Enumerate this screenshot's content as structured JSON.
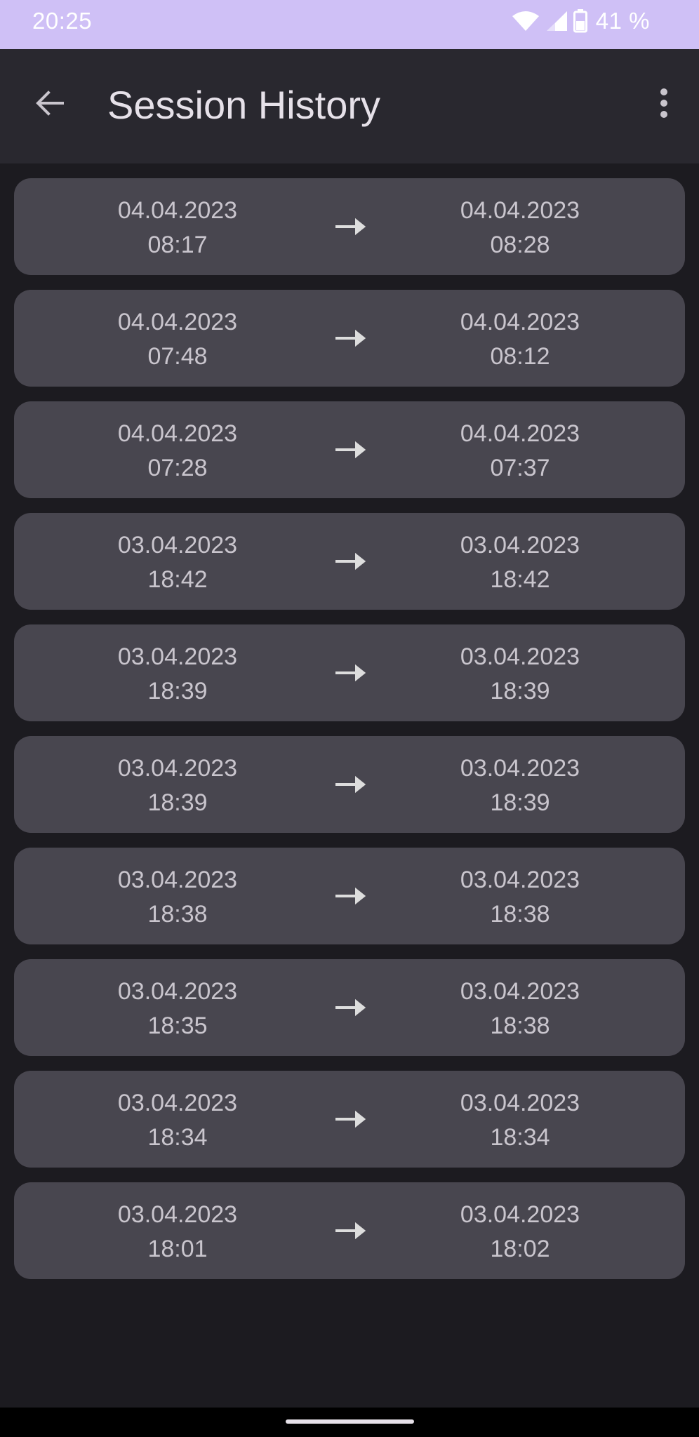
{
  "status_bar": {
    "time": "20:25",
    "battery": "41 %",
    "icons": [
      "wifi-icon",
      "cell-signal-icon",
      "battery-icon"
    ],
    "background": "#cfc0f6"
  },
  "app_bar": {
    "title": "Session History",
    "back_icon": "arrow-back-icon",
    "menu_icon": "more-vert-icon"
  },
  "sessions": [
    {
      "start_date": "04.04.2023",
      "start_time": "08:17",
      "end_date": "04.04.2023",
      "end_time": "08:28"
    },
    {
      "start_date": "04.04.2023",
      "start_time": "07:48",
      "end_date": "04.04.2023",
      "end_time": "08:12"
    },
    {
      "start_date": "04.04.2023",
      "start_time": "07:28",
      "end_date": "04.04.2023",
      "end_time": "07:37"
    },
    {
      "start_date": "03.04.2023",
      "start_time": "18:42",
      "end_date": "03.04.2023",
      "end_time": "18:42"
    },
    {
      "start_date": "03.04.2023",
      "start_time": "18:39",
      "end_date": "03.04.2023",
      "end_time": "18:39"
    },
    {
      "start_date": "03.04.2023",
      "start_time": "18:39",
      "end_date": "03.04.2023",
      "end_time": "18:39"
    },
    {
      "start_date": "03.04.2023",
      "start_time": "18:38",
      "end_date": "03.04.2023",
      "end_time": "18:38"
    },
    {
      "start_date": "03.04.2023",
      "start_time": "18:35",
      "end_date": "03.04.2023",
      "end_time": "18:38"
    },
    {
      "start_date": "03.04.2023",
      "start_time": "18:34",
      "end_date": "03.04.2023",
      "end_time": "18:34"
    },
    {
      "start_date": "03.04.2023",
      "start_time": "18:01",
      "end_date": "03.04.2023",
      "end_time": "18:02"
    }
  ],
  "colors": {
    "background": "#1c1b20",
    "app_bar": "#29282f",
    "card": "#48464f",
    "card_text": "#c9c5cd",
    "title_text": "#e6e1e9"
  }
}
